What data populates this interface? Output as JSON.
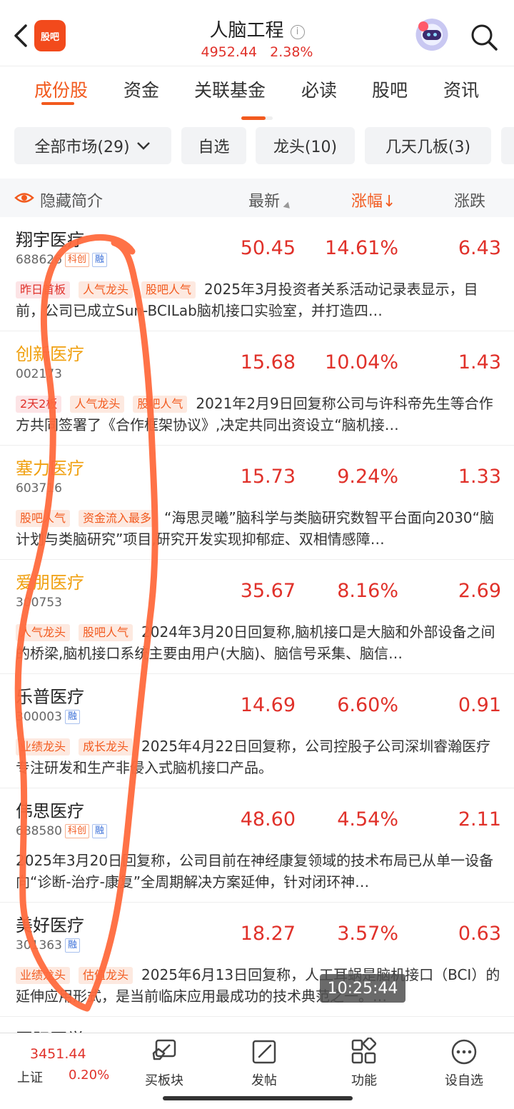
{
  "header": {
    "title": "人脑工程",
    "index_value": "4952.44",
    "index_pct": "2.38%",
    "logo_text": "股吧"
  },
  "tabs": [
    {
      "label": "成份股",
      "active": true
    },
    {
      "label": "资金"
    },
    {
      "label": "关联基金"
    },
    {
      "label": "必读"
    },
    {
      "label": "股吧"
    },
    {
      "label": "资讯"
    }
  ],
  "filters": [
    {
      "label": "全部市场(29)"
    },
    {
      "label": "自选"
    },
    {
      "label": "龙头(10)"
    },
    {
      "label": "几天几板(3)"
    }
  ],
  "columns": {
    "toggle": "隐藏简介",
    "price": "最新",
    "pct": "涨幅",
    "change": "涨跌"
  },
  "stocks": [
    {
      "name": "翔宇医疗",
      "code": "688626",
      "badges": [
        "科创",
        "融"
      ],
      "price": "50.45",
      "pct": "14.61%",
      "change": "6.43",
      "tags": [
        "昨日首板",
        "人气龙头",
        "股吧人气"
      ],
      "desc": "2025年3月投资者关系活动记录表显示，目前，公司已成立Sun-BCILab脑机接口实验室，并打造四…"
    },
    {
      "name": "创新医疗",
      "code": "002173",
      "badges": [],
      "price": "15.68",
      "pct": "10.04%",
      "change": "1.43",
      "tags": [
        "2天2板",
        "人气龙头",
        "股吧人气"
      ],
      "desc": "2021年2月9日回复称公司与许科帝先生等合作方共同签署了《合作框架协议》,决定共同出资设立“脑机接…"
    },
    {
      "name": "塞力医疗",
      "code": "603716",
      "badges": [],
      "price": "15.73",
      "pct": "9.24%",
      "change": "1.33",
      "tags": [
        "股吧人气",
        "资金流入最多"
      ],
      "desc": "“海思灵曦”脑科学与类脑研究数智平台面向2030“脑计划与类脑研究”项目,研究开发实现抑郁症、双相情感障…"
    },
    {
      "name": "爱朋医疗",
      "code": "300753",
      "badges": [],
      "price": "35.67",
      "pct": "8.16%",
      "change": "2.69",
      "tags": [
        "人气龙头",
        "股吧人气"
      ],
      "desc": "2024年3月20日回复称,脑机接口是大脑和外部设备之间的桥梁,脑机接口系统主要由用户(大脑)、脑信号采集、脑信…"
    },
    {
      "name": "乐普医疗",
      "code": "300003",
      "badges": [
        "融"
      ],
      "price": "14.69",
      "pct": "6.60%",
      "change": "0.91",
      "tags": [
        "业绩龙头",
        "成长龙头"
      ],
      "desc": "2025年4月22日回复称，公司控股子公司深圳睿瀚医疗专注研发和生产非侵入式脑机接口产品。"
    },
    {
      "name": "伟思医疗",
      "code": "688580",
      "badges": [
        "科创",
        "融"
      ],
      "price": "48.60",
      "pct": "4.54%",
      "change": "2.11",
      "tags": [],
      "desc": "2025年3月20日回复称，公司目前在神经康复领域的技术布局已从单一设备向“诊断-治疗-康复”全周期解决方案延伸，针对闭环神…"
    },
    {
      "name": "美好医疗",
      "code": "301363",
      "badges": [
        "融"
      ],
      "price": "18.27",
      "pct": "3.57%",
      "change": "0.63",
      "tags": [
        "业绩龙头",
        "估值龙头"
      ],
      "desc": "2025年6月13日回复称，人工耳蜗是脑机接口（BCI）的延伸应用形式，是当前临床应用最成功的技术典范之一。…"
    }
  ],
  "partial_row_name": "国际医学",
  "time_overlay": "10:25:44",
  "bottom": {
    "index_value": "3451.44",
    "index_name": "上证",
    "index_pct": "0.20%",
    "nav": [
      {
        "label": "买板块",
        "icon": "buy-sector-icon"
      },
      {
        "label": "发帖",
        "icon": "compose-icon"
      },
      {
        "label": "功能",
        "icon": "apps-icon"
      },
      {
        "label": "设自选",
        "icon": "more-icon"
      }
    ]
  },
  "colors": {
    "accent": "#f25a1e",
    "up": "#e0312a",
    "highlight_name": "#f0a010",
    "annotation": "#ff6a3d"
  }
}
